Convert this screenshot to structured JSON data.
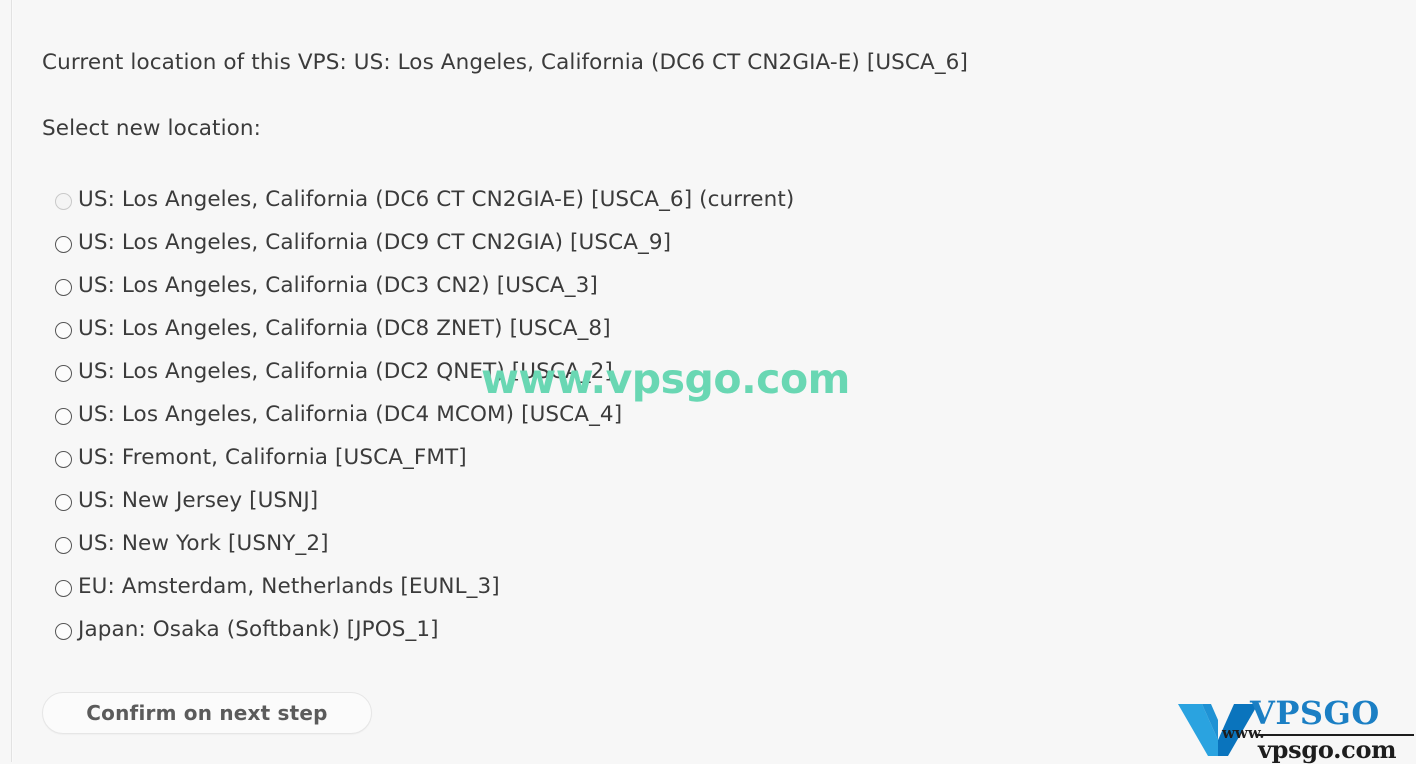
{
  "page": {
    "current_location_label": "Current location of this VPS: US: Los Angeles, California (DC6 CT CN2GIA-E) [USCA_6]",
    "select_prompt": "Select new location:"
  },
  "locations": [
    {
      "label": "US: Los Angeles, California (DC6 CT CN2GIA-E) [USCA_6] (current)",
      "code": "USCA_6",
      "current": true
    },
    {
      "label": "US: Los Angeles, California (DC9 CT CN2GIA) [USCA_9]",
      "code": "USCA_9",
      "current": false
    },
    {
      "label": "US: Los Angeles, California (DC3 CN2) [USCA_3]",
      "code": "USCA_3",
      "current": false
    },
    {
      "label": "US: Los Angeles, California (DC8 ZNET) [USCA_8]",
      "code": "USCA_8",
      "current": false
    },
    {
      "label": "US: Los Angeles, California (DC2 QNET) [USCA_2]",
      "code": "USCA_2",
      "current": false
    },
    {
      "label": "US: Los Angeles, California (DC4 MCOM) [USCA_4]",
      "code": "USCA_4",
      "current": false
    },
    {
      "label": "US: Fremont, California [USCA_FMT]",
      "code": "USCA_FMT",
      "current": false
    },
    {
      "label": "US: New Jersey [USNJ]",
      "code": "USNJ",
      "current": false
    },
    {
      "label": "US: New York [USNY_2]",
      "code": "USNY_2",
      "current": false
    },
    {
      "label": "EU: Amsterdam, Netherlands [EUNL_3]",
      "code": "EUNL_3",
      "current": false
    },
    {
      "label": "Japan: Osaka (Softbank) [JPOS_1]",
      "code": "JPOS_1",
      "current": false
    }
  ],
  "actions": {
    "confirm_label": "Confirm on next step"
  },
  "watermark": {
    "text": "www.vpsgo.com",
    "color": "#69d7b3"
  },
  "logo": {
    "brand": "VPSGO",
    "www": "www.",
    "domain": "vpsgo.com",
    "mark_color_light": "#2aa3e0",
    "mark_color_dark": "#0a74bd",
    "brand_color": "#1b7fc4"
  }
}
